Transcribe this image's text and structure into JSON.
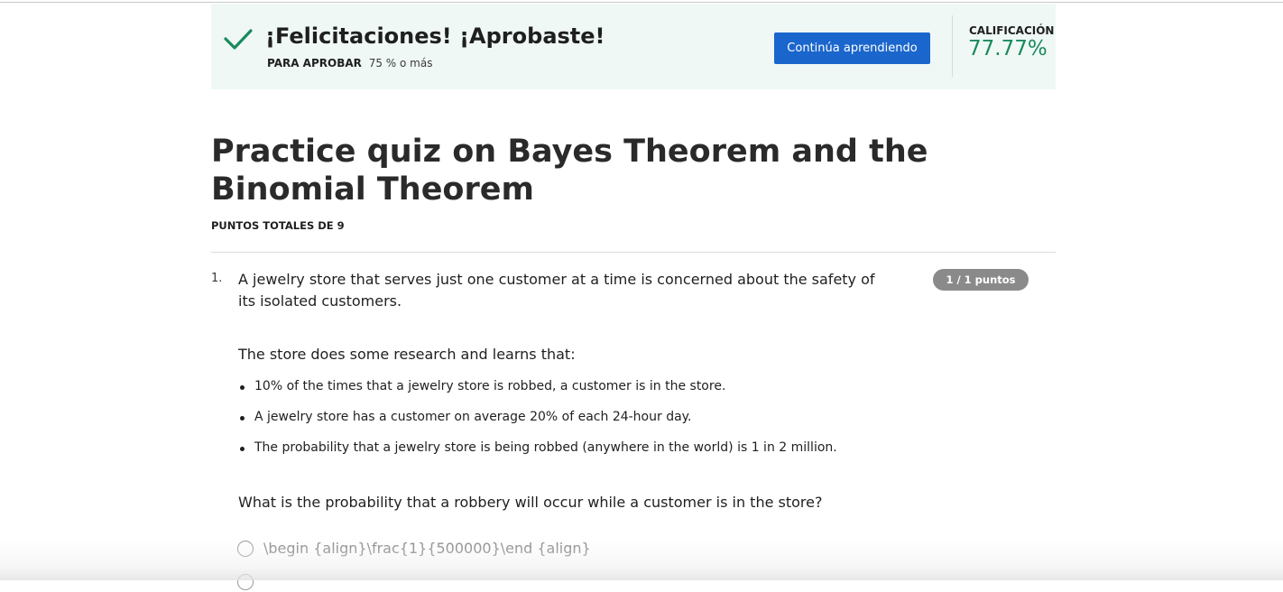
{
  "banner": {
    "title": "¡Felicitaciones! ¡Aprobaste!",
    "pass_label": "PARA APROBAR",
    "pass_value": "75 % o más",
    "continue_label": "Continúa aprendiendo",
    "grade_label": "CALIFICACIÓN",
    "grade_value": "77.77%",
    "icon": "check-icon",
    "accent_color": "#1a8a5c",
    "button_color": "#1a66cc"
  },
  "quiz": {
    "title": "Practice quiz on Bayes Theorem and the Binomial Theorem",
    "total_points": "PUNTOS TOTALES DE 9"
  },
  "question1": {
    "number": "1.",
    "prompt": "A jewelry store that serves just one customer at a time is concerned about the safety of its isolated customers.",
    "score": "1 / 1 puntos",
    "intro": "The store does some research and learns that:",
    "facts": [
      "10% of the times that a jewelry store is robbed, a customer is in the store.",
      "A jewelry store has a customer on average 20% of each 24-hour day.",
      "The probability that a jewelry store is being robbed (anywhere in the world) is 1 in 2 million."
    ],
    "question": "What is the probability that a robbery will occur while a customer is in the store?",
    "options": [
      "\\begin {align}\\frac{1}{500000}\\end {align}"
    ]
  }
}
